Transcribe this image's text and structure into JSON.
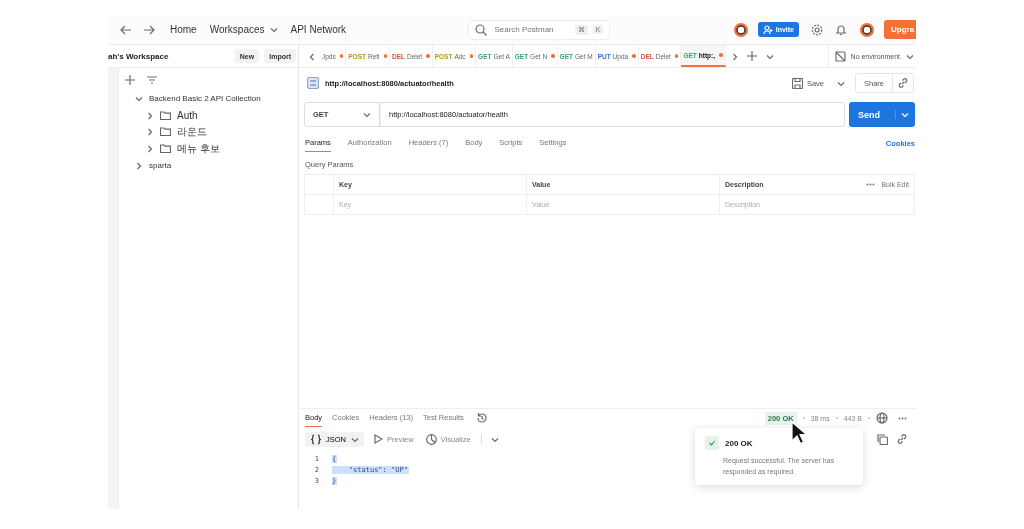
{
  "topbar": {
    "nav": [
      "Home",
      "Workspaces",
      "API Network"
    ],
    "search": {
      "placeholder": "Search Postman",
      "shortcut": [
        "⌘",
        "K"
      ]
    },
    "invite": "Invite",
    "upgrade": "Upgra"
  },
  "sidebar": {
    "workspace": "ah's Workspace",
    "buttons": [
      "New",
      "Import"
    ],
    "tree": [
      {
        "label": "Backend Basic 2 API Collection",
        "kind": "collection",
        "expanded": true,
        "children": [
          {
            "label": "Auth",
            "kind": "folder",
            "expanded": false
          },
          {
            "label": "라운드",
            "kind": "folder",
            "expanded": false
          },
          {
            "label": "메뉴 후보",
            "kind": "folder",
            "expanded": false
          }
        ]
      },
      {
        "label": "sparta",
        "kind": "collection",
        "expanded": false
      }
    ]
  },
  "tabs": [
    {
      "name": "Jpds",
      "unsaved": true,
      "selected": false
    },
    {
      "method": "POST",
      "name": "Refi",
      "unsaved": true,
      "selected": false
    },
    {
      "method": "DEL",
      "name": "Delet",
      "unsaved": true,
      "selected": false
    },
    {
      "method": "POST",
      "name": "Adc",
      "unsaved": true,
      "selected": false
    },
    {
      "method": "GET",
      "name": "Get A",
      "unsaved": false,
      "selected": false
    },
    {
      "method": "GET",
      "name": "Get N",
      "unsaved": true,
      "selected": false
    },
    {
      "method": "GET",
      "name": "Get M",
      "unsaved": false,
      "selected": false
    },
    {
      "method": "PUT",
      "name": "Upda",
      "unsaved": true,
      "selected": false
    },
    {
      "method": "DEL",
      "name": "Delet",
      "unsaved": true,
      "selected": false
    },
    {
      "method": "GET",
      "name": "http:,",
      "unsaved": true,
      "selected": true
    }
  ],
  "environment": "No environment",
  "request": {
    "title": "http://localhost:8080/actuator/health",
    "save": "Save",
    "share": "Share",
    "method": "GET",
    "url": "http://localhost:8080/actuator/health",
    "send": "Send",
    "tabs": [
      {
        "label": "Params",
        "selected": true
      },
      {
        "label": "Authorization",
        "selected": false
      },
      {
        "label": "Headers (7)",
        "selected": false
      },
      {
        "label": "Body",
        "selected": false
      },
      {
        "label": "Scripts",
        "selected": false
      },
      {
        "label": "Settings",
        "selected": false
      }
    ],
    "cookies": "Cookies",
    "section": "Query Params",
    "table": {
      "columns": [
        "Key",
        "Value",
        "Description"
      ],
      "bulk_edit": "Bulk Edit",
      "placeholders": [
        "Key",
        "Value",
        "Description"
      ]
    }
  },
  "response": {
    "tabs": [
      {
        "label": "Body",
        "selected": true
      },
      {
        "label": "Cookies",
        "selected": false
      },
      {
        "label": "Headers (13)",
        "selected": false
      },
      {
        "label": "Test Results",
        "selected": false
      }
    ],
    "status": "200 OK",
    "time": "38 ms",
    "size": "443 B",
    "format": "JSON",
    "preview": "Preview",
    "visualize": "Visualize",
    "lines": [
      {
        "number": "1",
        "text": "{"
      },
      {
        "number": "2",
        "text": "    \"status\": \"UP\""
      },
      {
        "number": "3",
        "text": "}"
      }
    ],
    "tooltip": {
      "title": "200 OK",
      "text": "Request successful. The server has responded as required."
    }
  }
}
